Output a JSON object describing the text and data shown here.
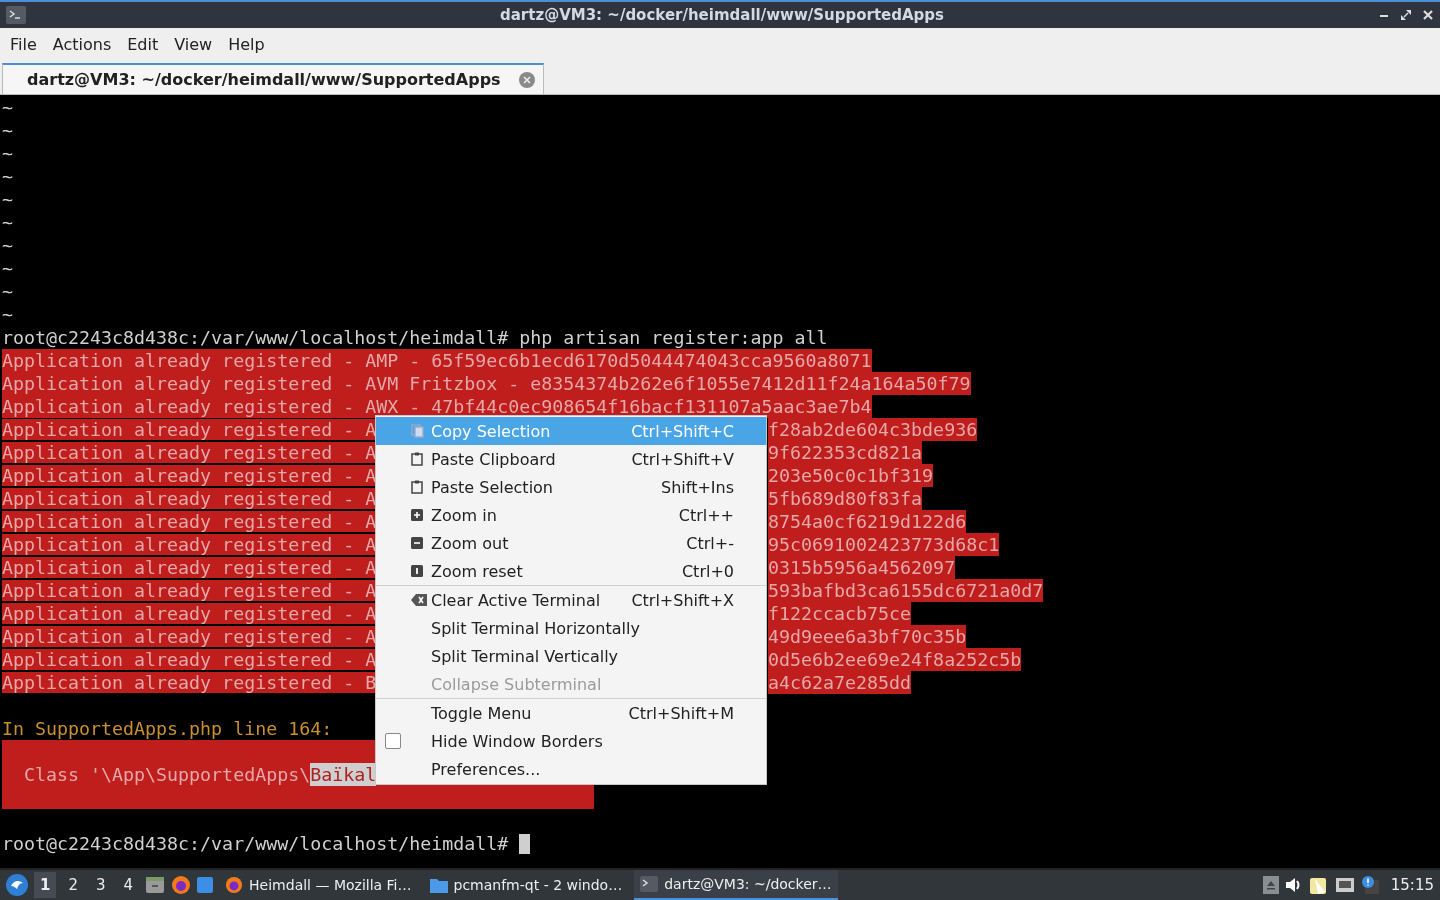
{
  "window": {
    "title": "dartz@VM3: ~/docker/heimdall/www/SupportedApps"
  },
  "menubar": [
    "File",
    "Actions",
    "Edit",
    "View",
    "Help"
  ],
  "tabs": [
    {
      "label": "dartz@VM3: ~/docker/heimdall/www/SupportedApps",
      "selected": true
    }
  ],
  "terminal": {
    "tildes": [
      "~",
      "~",
      "~",
      "~",
      "~",
      "~",
      "~",
      "~",
      "~",
      "~"
    ],
    "lines": [
      {
        "kind": "prompt",
        "text": "root@c2243c8d438c:/var/www/localhost/heimdall# php artisan register:app all"
      },
      {
        "kind": "highlight",
        "text": "Application already registered - AMP - 65f59ec6b1ecd6170d5044474043cca9560a8071"
      },
      {
        "kind": "highlight",
        "text": "Application already registered - AVM Fritzbox - e8354374b262e6f1055e7412d11f24a164a50f79"
      },
      {
        "kind": "highlight",
        "text": "Application already registered - AWX - 47bf44c0ec908654f16bacf131107a5aac3ae7b4"
      },
      {
        "kind": "split",
        "text": "Application already registered - A",
        "tail": "f28ab2de604c3bde936"
      },
      {
        "kind": "split",
        "text": "Application already registered - A",
        "tail": "9f622353cd821a"
      },
      {
        "kind": "split",
        "text": "Application already registered - A",
        "tail": "203e50c0c1bf319"
      },
      {
        "kind": "split",
        "text": "Application already registered - A",
        "tail": "5fb689d80f83fa"
      },
      {
        "kind": "split",
        "text": "Application already registered - A",
        "tail": "8754a0cf6219d122d6"
      },
      {
        "kind": "split",
        "text": "Application already registered - A",
        "tail": "95c0691002423773d68c1"
      },
      {
        "kind": "split",
        "text": "Application already registered - A",
        "tail": "0315b5956a4562097"
      },
      {
        "kind": "split",
        "text": "Application already registered - A",
        "tail": "593bafbd3ca6155dc6721a0d7"
      },
      {
        "kind": "split",
        "text": "Application already registered - A",
        "tail": "f122ccacb75ce"
      },
      {
        "kind": "split",
        "text": "Application already registered - A",
        "tail": "49d9eee6a3bf70c35b"
      },
      {
        "kind": "split",
        "text": "Application already registered - A",
        "tail": "0d5e6b2ee69e24f8a252c5b"
      },
      {
        "kind": "split",
        "text": "Application already registered - B",
        "tail": "a4c62a7e285dd"
      },
      {
        "kind": "blank"
      },
      {
        "kind": "warning",
        "text": "In SupportedApps.php line 164:"
      },
      {
        "kind": "error",
        "text": "  Class '\\App\\SupportedApps\\",
        "mark": "Baïkal"
      },
      {
        "kind": "blank"
      },
      {
        "kind": "cursor",
        "text": "root@c2243c8d438c:/var/www/localhost/heimdall# "
      }
    ]
  },
  "context_menu": [
    {
      "kind": "item",
      "label": "Copy Selection",
      "shortcut": "Ctrl+Shift+C",
      "selected": true,
      "disabled": false
    },
    {
      "kind": "item",
      "label": "Paste Clipboard",
      "shortcut": "Ctrl+Shift+V",
      "selected": false,
      "disabled": false
    },
    {
      "kind": "item",
      "label": "Paste Selection",
      "shortcut": "Shift+Ins",
      "selected": false,
      "disabled": false
    },
    {
      "kind": "item",
      "label": "Zoom in",
      "shortcut": "Ctrl++",
      "selected": false,
      "disabled": false
    },
    {
      "kind": "item",
      "label": "Zoom out",
      "shortcut": "Ctrl+-",
      "selected": false,
      "disabled": false
    },
    {
      "kind": "item",
      "label": "Zoom reset",
      "shortcut": "Ctrl+0",
      "selected": false,
      "disabled": false
    },
    {
      "kind": "separator"
    },
    {
      "kind": "item",
      "label": "Clear Active Terminal",
      "shortcut": "Ctrl+Shift+X",
      "selected": false,
      "disabled": false
    },
    {
      "kind": "item",
      "label": "Split Terminal Horizontally",
      "selected": false,
      "disabled": false
    },
    {
      "kind": "item",
      "label": "Split Terminal Vertically",
      "selected": false,
      "disabled": false
    },
    {
      "kind": "item",
      "label": "Collapse Subterminal",
      "selected": false,
      "disabled": true
    },
    {
      "kind": "separator"
    },
    {
      "kind": "item",
      "label": "Toggle Menu",
      "shortcut": "Ctrl+Shift+M",
      "selected": false,
      "disabled": false
    },
    {
      "kind": "check",
      "label": "Hide Window Borders",
      "checked": false,
      "selected": false,
      "disabled": false
    },
    {
      "kind": "item",
      "label": "Preferences...",
      "selected": false,
      "disabled": false
    }
  ],
  "taskbar": {
    "desktops": [
      {
        "label": "1",
        "selected": true
      },
      {
        "label": "2",
        "selected": false
      },
      {
        "label": "3",
        "selected": false
      },
      {
        "label": "4",
        "selected": false
      }
    ],
    "tasks": [
      {
        "label": "Heimdall — Mozilla Fi…",
        "selected": false
      },
      {
        "label": "pcmanfm-qt - 2 windo…",
        "selected": false
      },
      {
        "label": "dartz@VM3: ~/docker…",
        "selected": true
      }
    ],
    "clock": "15:15"
  }
}
